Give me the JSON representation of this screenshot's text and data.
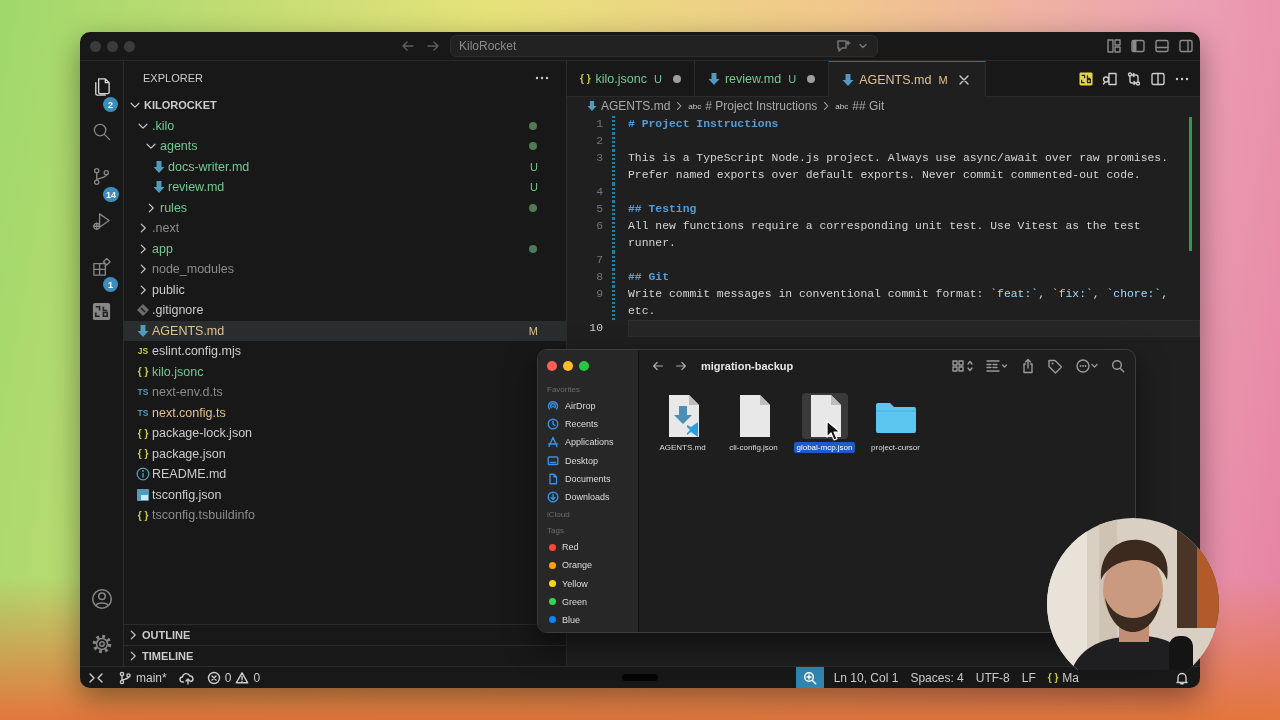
{
  "title_bar": {
    "title": "KiloRocket"
  },
  "activity_bar": {
    "items": [
      {
        "kind": "explorer",
        "badge": "2",
        "selected": true
      },
      {
        "kind": "search",
        "selected": false
      },
      {
        "kind": "source-control",
        "badge": "14",
        "selected": false
      },
      {
        "kind": "run",
        "selected": false
      },
      {
        "kind": "extensions",
        "badge": "1",
        "selected": false
      },
      {
        "kind": "kilo",
        "selected": false
      }
    ],
    "bottom": [
      {
        "kind": "account"
      },
      {
        "kind": "settings"
      }
    ]
  },
  "sidebar": {
    "title": "EXPLORER",
    "root": {
      "label": "KILOROCKET",
      "expanded": true
    },
    "tree": [
      {
        "name": ".kilo",
        "kind": "folder",
        "expanded": true,
        "selected": false,
        "color": "#73c991",
        "dot": true,
        "children": [
          {
            "name": "agents",
            "kind": "folder",
            "expanded": true,
            "selected": false,
            "color": "#73c991",
            "dot": true,
            "children": [
              {
                "name": "docs-writer.md",
                "kind": "markdown",
                "selected": false,
                "color": "#73c991",
                "badge": "U"
              },
              {
                "name": "review.md",
                "kind": "markdown",
                "selected": false,
                "color": "#73c991",
                "badge": "U"
              }
            ]
          },
          {
            "name": "rules",
            "kind": "folder",
            "expanded": false,
            "selected": false,
            "color": "#73c991",
            "dot": true
          }
        ]
      },
      {
        "name": ".next",
        "kind": "folder",
        "expanded": false,
        "selected": false,
        "color": "#8c8c8c"
      },
      {
        "name": "app",
        "kind": "folder",
        "expanded": false,
        "selected": false,
        "color": "#73c991",
        "dot": true
      },
      {
        "name": "node_modules",
        "kind": "folder",
        "expanded": false,
        "selected": false,
        "color": "#8c8c8c"
      },
      {
        "name": "public",
        "kind": "folder",
        "expanded": false,
        "selected": false,
        "color": "#cccccc"
      },
      {
        "name": ".gitignore",
        "kind": "git",
        "selected": false,
        "color": "#cccccc"
      },
      {
        "name": "AGENTS.md",
        "kind": "markdown",
        "selected": true,
        "color": "#e2c08d",
        "badge": "M"
      },
      {
        "name": "eslint.config.mjs",
        "kind": "js",
        "glyph": "JS",
        "selected": false,
        "color": "#cccccc"
      },
      {
        "name": "kilo.jsonc",
        "kind": "json",
        "glyph": "{ }",
        "selected": false,
        "color": "#73c991"
      },
      {
        "name": "next-env.d.ts",
        "kind": "ts",
        "glyph": "TS",
        "selected": false,
        "color": "#8c8c8c"
      },
      {
        "name": "next.config.ts",
        "kind": "ts",
        "glyph": "TS",
        "selected": false,
        "color": "#e2c08d"
      },
      {
        "name": "package-lock.json",
        "kind": "json",
        "glyph": "{ }",
        "selected": false,
        "color": "#cccccc"
      },
      {
        "name": "package.json",
        "kind": "json",
        "glyph": "{ }",
        "selected": false,
        "color": "#cccccc"
      },
      {
        "name": "README.md",
        "kind": "info",
        "selected": false,
        "color": "#cccccc"
      },
      {
        "name": "tsconfig.json",
        "kind": "tsconfig",
        "selected": false,
        "color": "#cccccc"
      },
      {
        "name": "tsconfig.tsbuildinfo",
        "kind": "json",
        "glyph": "{ }",
        "selected": false,
        "color": "#8c8c8c"
      }
    ],
    "panels": [
      {
        "label": "OUTLINE",
        "expanded": false
      },
      {
        "label": "TIMELINE",
        "expanded": false
      }
    ]
  },
  "editor": {
    "tabs": [
      {
        "label": "kilo.jsonc",
        "kind": "json",
        "glyph": "{ }",
        "color": "#73c991",
        "badge": "U",
        "dirty": true,
        "selected": false
      },
      {
        "label": "review.md",
        "kind": "markdown",
        "color": "#73c991",
        "badge": "U",
        "dirty": true,
        "selected": false
      },
      {
        "label": "AGENTS.md",
        "kind": "markdown",
        "color": "#e2c08d",
        "badge": "M",
        "dirty": false,
        "selected": true
      }
    ],
    "breadcrumbs": [
      {
        "label": "AGENTS.md",
        "kind": "markdown"
      },
      {
        "label": "# Project Instructions",
        "kind": "symbol",
        "symbol": "abc"
      },
      {
        "label": "## Git",
        "kind": "symbol",
        "symbol": "abc"
      }
    ],
    "lines": [
      {
        "number": "1",
        "changed": true,
        "current": false,
        "segments": [
          {
            "text": "# Project Instructions",
            "kind": "heading"
          }
        ]
      },
      {
        "number": "2",
        "changed": true,
        "current": false
      },
      {
        "number": "3",
        "changed": true,
        "current": false,
        "segments": [
          {
            "text": "This is a TypeScript Node.js project. Always use async/await over raw promises. Prefer named exports over default exports. Never commit commented-out code.",
            "kind": "text"
          }
        ]
      },
      {
        "number": "4",
        "changed": true,
        "current": false
      },
      {
        "number": "5",
        "changed": true,
        "current": false,
        "segments": [
          {
            "text": "## Testing",
            "kind": "heading"
          }
        ]
      },
      {
        "number": "6",
        "changed": true,
        "current": false,
        "segments": [
          {
            "text": "All new functions require a corresponding unit test. Use Vitest as the test runner.",
            "kind": "text"
          }
        ]
      },
      {
        "number": "7",
        "changed": true,
        "current": false
      },
      {
        "number": "8",
        "changed": true,
        "current": false,
        "segments": [
          {
            "text": "## Git",
            "kind": "heading"
          }
        ]
      },
      {
        "number": "9",
        "changed": true,
        "current": false,
        "segments": [
          {
            "text": "Write commit messages in conventional commit format: ",
            "kind": "text"
          },
          {
            "text": "`feat:`",
            "kind": "code"
          },
          {
            "text": ", ",
            "kind": "text"
          },
          {
            "text": "`fix:`",
            "kind": "code"
          },
          {
            "text": ", ",
            "kind": "text"
          },
          {
            "text": "`chore:`",
            "kind": "code"
          },
          {
            "text": ", etc.",
            "kind": "text"
          }
        ]
      },
      {
        "number": "10",
        "changed": false,
        "current": true
      }
    ]
  },
  "finder": {
    "title": "migration-backup",
    "sidebar": [
      {
        "heading": "Favorites",
        "items": [
          {
            "label": "AirDrop",
            "kind": "airdrop"
          },
          {
            "label": "Recents",
            "kind": "recents"
          },
          {
            "label": "Applications",
            "kind": "applications"
          },
          {
            "label": "Desktop",
            "kind": "desktop"
          },
          {
            "label": "Documents",
            "kind": "documents"
          },
          {
            "label": "Downloads",
            "kind": "downloads"
          }
        ]
      },
      {
        "heading": "iCloud"
      },
      {
        "heading": "Tags",
        "items": [
          {
            "label": "Red",
            "kind": "tag",
            "color": "#ff453a"
          },
          {
            "label": "Orange",
            "kind": "tag",
            "color": "#ff9f0a"
          },
          {
            "label": "Yellow",
            "kind": "tag",
            "color": "#ffd60a"
          },
          {
            "label": "Green",
            "kind": "tag",
            "color": "#32d74b"
          },
          {
            "label": "Blue",
            "kind": "tag",
            "color": "#0a84ff"
          }
        ]
      }
    ],
    "files": [
      {
        "name": "AGENTS.md",
        "kind": "markdown-doc",
        "selected": false
      },
      {
        "name": "cli-config.json",
        "kind": "document",
        "selected": false
      },
      {
        "name": "global-mcp.json",
        "kind": "document",
        "selected": true
      },
      {
        "name": "project-cursor",
        "kind": "folder",
        "selected": false
      }
    ]
  },
  "status_bar": {
    "left": [
      {
        "kind": "remote"
      },
      {
        "kind": "branch",
        "text": "main*"
      },
      {
        "kind": "sync"
      },
      {
        "kind": "problems",
        "errors": "0",
        "warnings": "0"
      }
    ],
    "right": [
      {
        "kind": "zoom"
      },
      {
        "kind": "text",
        "text": "Ln 10, Col 1"
      },
      {
        "kind": "text",
        "text": "Spaces: 4"
      },
      {
        "kind": "text",
        "text": "UTF-8"
      },
      {
        "kind": "text",
        "text": "LF"
      },
      {
        "kind": "language",
        "glyph": "{ }",
        "text": "Ma"
      },
      {
        "kind": "bell"
      }
    ]
  }
}
